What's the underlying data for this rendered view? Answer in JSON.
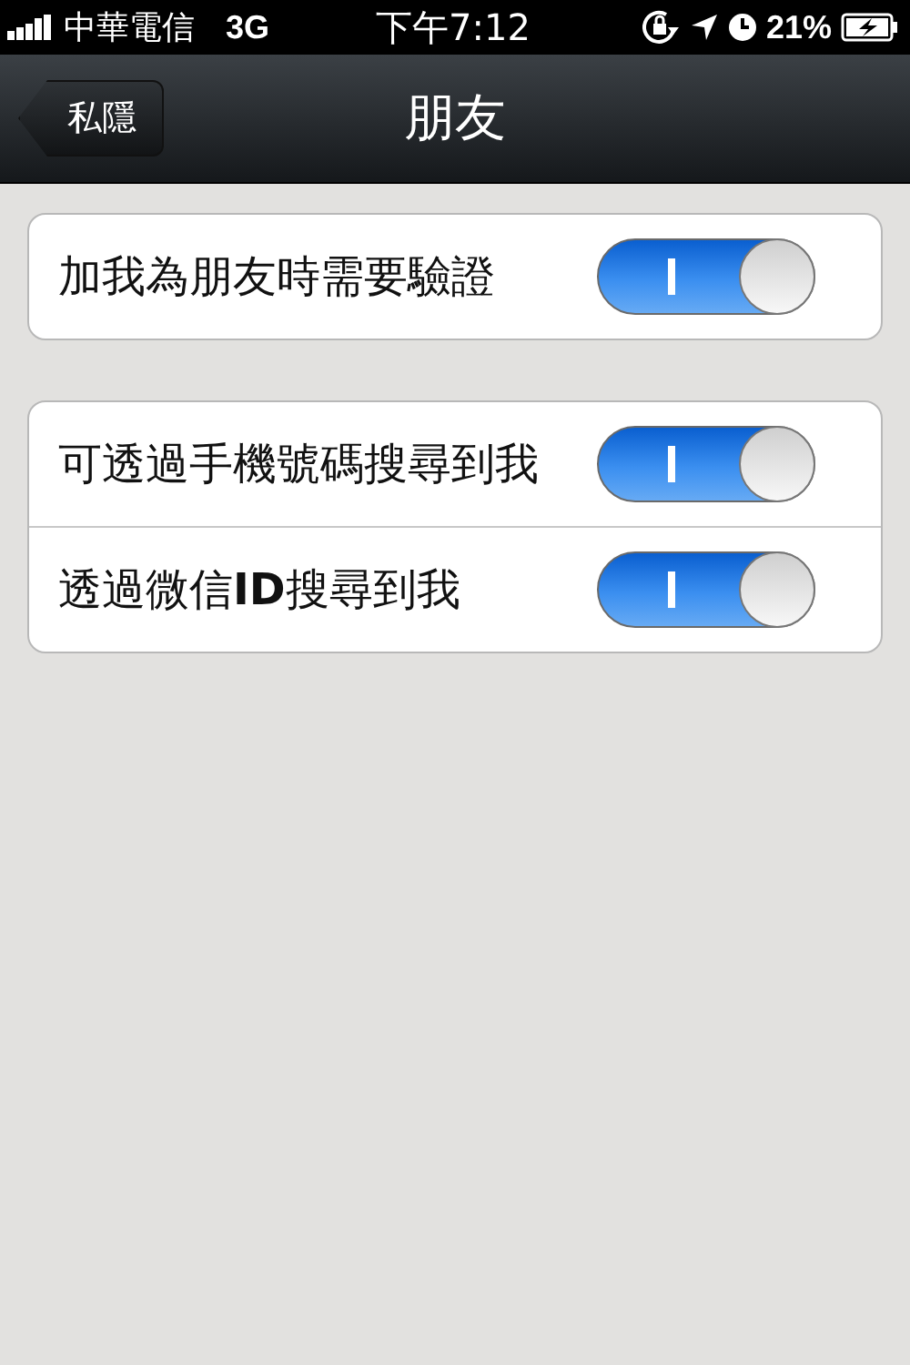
{
  "status_bar": {
    "carrier": "中華電信",
    "network": "3G",
    "time": "下午7:12",
    "battery": "21%"
  },
  "nav_bar": {
    "back": "私隱",
    "title": "朋友"
  },
  "sections": [
    {
      "rows": [
        {
          "label": "加我為朋友時需要驗證",
          "on": true
        }
      ]
    },
    {
      "rows": [
        {
          "label": "可透過手機號碼搜尋到我",
          "on": true
        },
        {
          "label": "透過微信**ID**搜尋到我",
          "on": true
        }
      ]
    }
  ]
}
